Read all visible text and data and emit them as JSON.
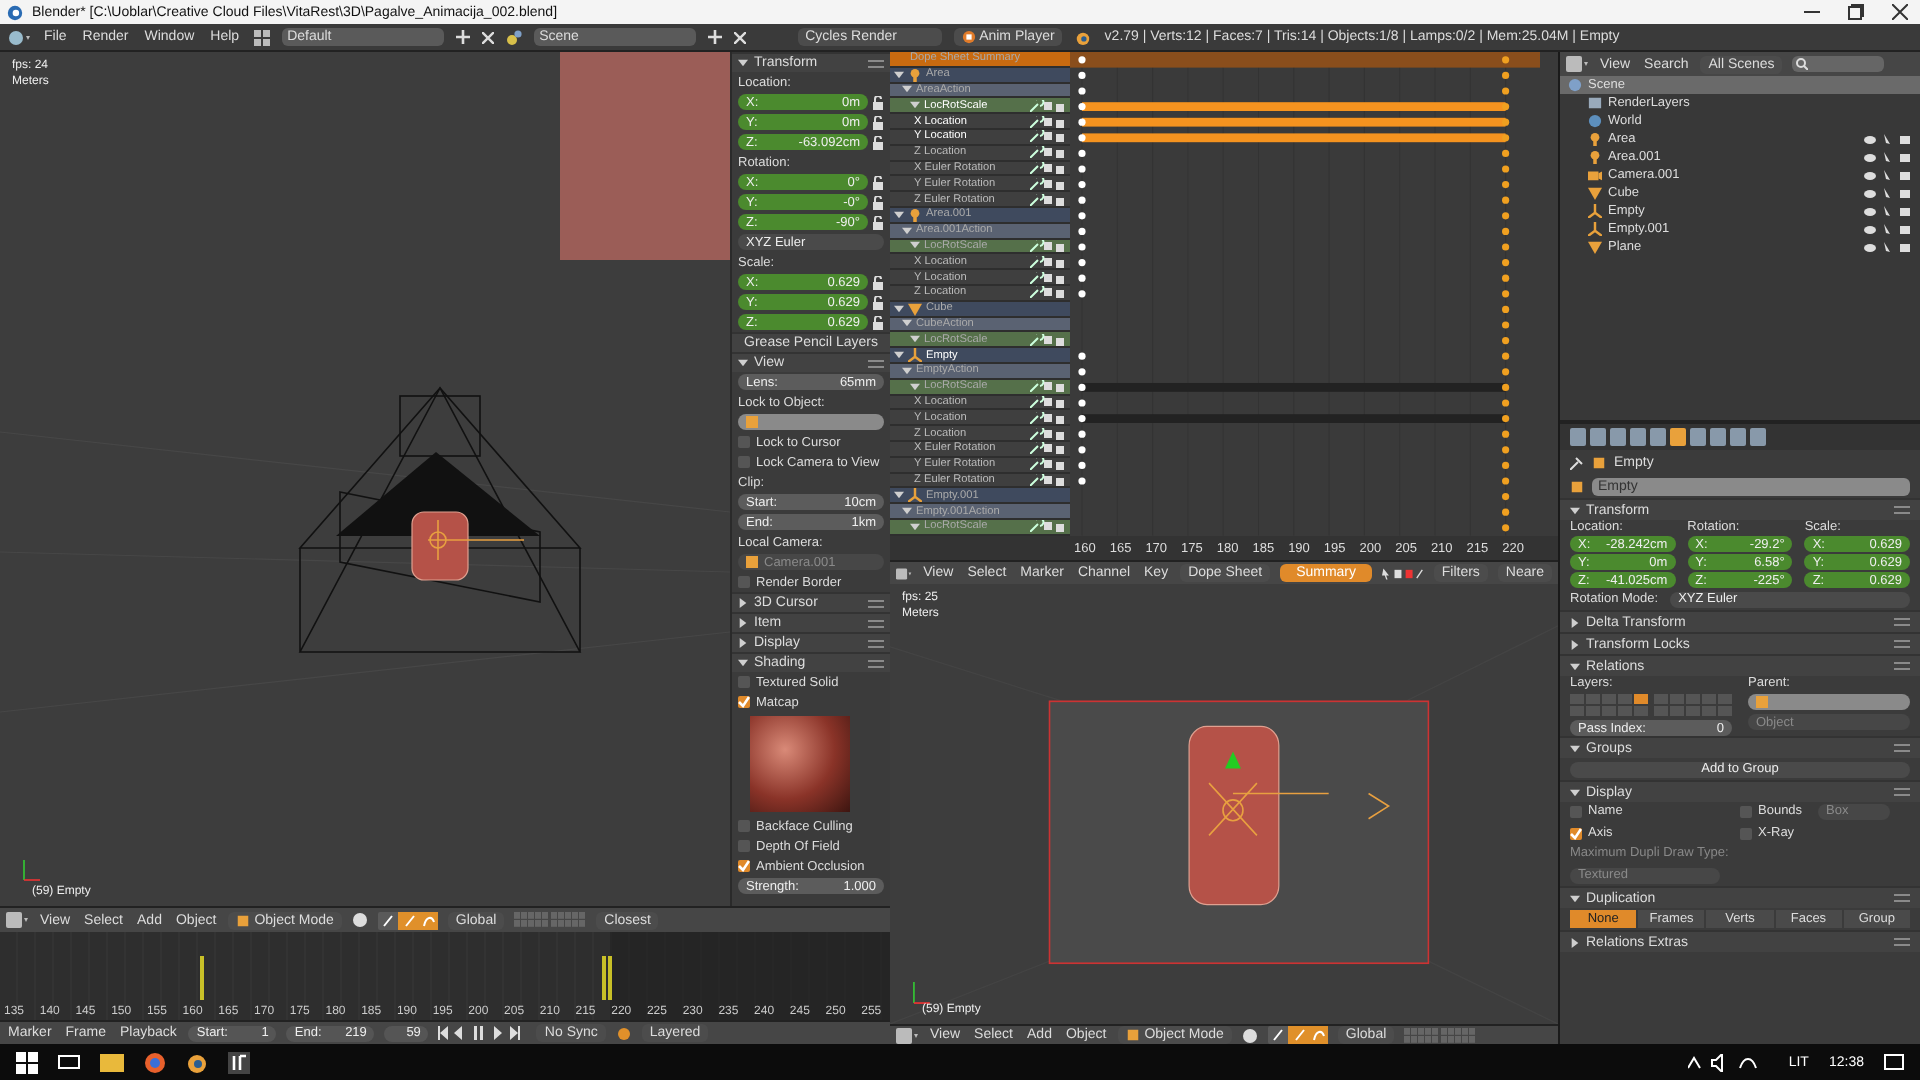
{
  "window": {
    "title": "Blender* [C:\\Uoblar\\Creative Cloud Files\\VitaRest\\3D\\Pagalve_Animacija_002.blend]"
  },
  "menubar": {
    "menus": [
      "File",
      "Render",
      "Window",
      "Help"
    ],
    "layout": "Default",
    "scene": "Scene",
    "engine": "Cycles Render",
    "player": "Anim Player",
    "stats": "v2.79 | Verts:12 | Faces:7 | Tris:14 | Objects:1/8 | Lamps:0/2 | Mem:25.04M | Empty"
  },
  "viewport": {
    "fps": "fps: 24",
    "units": "Meters",
    "object": "(59) Empty",
    "header": {
      "menus": [
        "View",
        "Select",
        "Add",
        "Object"
      ],
      "mode": "Object Mode",
      "orientation": "Global",
      "snap": "Closest"
    }
  },
  "npanel": {
    "items": [
      {
        "kind": "section",
        "title": "Transform",
        "expanded": true
      },
      {
        "kind": "label",
        "text": "Location:"
      },
      {
        "kind": "transform",
        "label": "X:",
        "value": "0m"
      },
      {
        "kind": "transform",
        "label": "Y:",
        "value": "0m"
      },
      {
        "kind": "transform",
        "label": "Z:",
        "value": "-63.092cm"
      },
      {
        "kind": "label",
        "text": "Rotation:"
      },
      {
        "kind": "transform",
        "label": "X:",
        "value": "0°"
      },
      {
        "kind": "transform",
        "label": "Y:",
        "value": "-0°"
      },
      {
        "kind": "transform",
        "label": "Z:",
        "value": "-90°"
      },
      {
        "kind": "dropdown",
        "value": "XYZ Euler"
      },
      {
        "kind": "label",
        "text": "Scale:"
      },
      {
        "kind": "transform",
        "label": "X:",
        "value": "0.629"
      },
      {
        "kind": "transform",
        "label": "Y:",
        "value": "0.629"
      },
      {
        "kind": "transform",
        "label": "Z:",
        "value": "0.629"
      },
      {
        "kind": "section",
        "title": "Grease Pencil Layers",
        "expanded": false
      },
      {
        "kind": "section",
        "title": "View",
        "expanded": true
      },
      {
        "kind": "number",
        "label": "Lens:",
        "value": "65mm"
      },
      {
        "kind": "label",
        "text": "Lock to Object:"
      },
      {
        "kind": "object_field",
        "disabled": false
      },
      {
        "kind": "checkbox",
        "label": "Lock to Cursor",
        "checked": false
      },
      {
        "kind": "checkbox",
        "label": "Lock Camera to View",
        "checked": false
      },
      {
        "kind": "label",
        "text": "Clip:"
      },
      {
        "kind": "number",
        "label": "Start:",
        "value": "10cm"
      },
      {
        "kind": "number",
        "label": "End:",
        "value": "1km"
      },
      {
        "kind": "label",
        "text": "Local Camera:"
      },
      {
        "kind": "object_field",
        "value": "Camera.001",
        "disabled": true
      },
      {
        "kind": "checkbox",
        "label": "Render Border",
        "checked": false
      },
      {
        "kind": "section",
        "title": "3D Cursor",
        "expanded": false
      },
      {
        "kind": "section",
        "title": "Item",
        "expanded": false
      },
      {
        "kind": "section",
        "title": "Display",
        "expanded": false
      },
      {
        "kind": "section",
        "title": "Shading",
        "expanded": true
      },
      {
        "kind": "checkbox",
        "label": "Textured Solid",
        "checked": false
      },
      {
        "kind": "checkbox",
        "label": "Matcap",
        "checked": true
      },
      {
        "kind": "matcap"
      },
      {
        "kind": "checkbox",
        "label": "Backface Culling",
        "checked": false
      },
      {
        "kind": "checkbox",
        "label": "Depth Of Field",
        "checked": false
      },
      {
        "kind": "checkbox",
        "label": "Ambient Occlusion",
        "checked": true
      },
      {
        "kind": "number",
        "label": "Strength:",
        "value": "1.000"
      }
    ]
  },
  "timeline": {
    "ticks": [
      "135",
      "140",
      "145",
      "150",
      "155",
      "160",
      "165",
      "170",
      "175",
      "180",
      "185",
      "190",
      "195",
      "200",
      "205",
      "210",
      "215",
      "220",
      "225",
      "230",
      "235",
      "240",
      "245",
      "250",
      "255"
    ],
    "header": {
      "menus": [
        "Marker",
        "Frame",
        "Playback"
      ],
      "start_label": "Start:",
      "start": "1",
      "end_label": "End:",
      "end": "219",
      "frame": "59",
      "sync": "No Sync",
      "keying": "Layered"
    }
  },
  "dopesheet": {
    "summary": "Dope Sheet Summary",
    "channels": [
      {
        "kind": "lamp",
        "name": "Area",
        "start_key": true,
        "held": false,
        "selected": false,
        "children": [
          {
            "kind": "action",
            "name": "AreaAction",
            "start_key": true,
            "held": false,
            "selected": false,
            "children": [
              {
                "kind": "group",
                "name": "LocRotScale",
                "start_key": true,
                "held": true,
                "selected": true,
                "children": [
                  {
                    "kind": "fcurve",
                    "name": "X Location",
                    "start_key": true,
                    "held": true,
                    "selected": true
                  },
                  {
                    "kind": "fcurve",
                    "name": "Y Location",
                    "start_key": true,
                    "held": true,
                    "selected": true
                  },
                  {
                    "kind": "fcurve",
                    "name": "Z Location",
                    "start_key": true,
                    "held": false,
                    "selected": false
                  },
                  {
                    "kind": "fcurve",
                    "name": "X Euler Rotation",
                    "start_key": true,
                    "held": false,
                    "selected": false
                  },
                  {
                    "kind": "fcurve",
                    "name": "Y Euler Rotation",
                    "start_key": true,
                    "held": false,
                    "selected": false
                  },
                  {
                    "kind": "fcurve",
                    "name": "Z Euler Rotation",
                    "start_key": true,
                    "held": false,
                    "selected": false
                  }
                ]
              }
            ]
          }
        ]
      },
      {
        "kind": "lamp",
        "name": "Area.001",
        "start_key": true,
        "held": false,
        "selected": false,
        "children": [
          {
            "kind": "action",
            "name": "Area.001Action",
            "start_key": true,
            "held": false,
            "selected": false,
            "children": [
              {
                "kind": "group",
                "name": "LocRotScale",
                "start_key": true,
                "held": false,
                "selected": false,
                "children": [
                  {
                    "kind": "fcurve",
                    "name": "X Location",
                    "start_key": true,
                    "held": false,
                    "selected": false
                  },
                  {
                    "kind": "fcurve",
                    "name": "Y Location",
                    "start_key": true,
                    "held": false,
                    "selected": false
                  },
                  {
                    "kind": "fcurve",
                    "name": "Z Location",
                    "start_key": true,
                    "held": false,
                    "selected": false
                  }
                ]
              }
            ]
          }
        ]
      },
      {
        "kind": "mesh",
        "name": "Cube",
        "start_key": false,
        "held": false,
        "selected": false,
        "children": [
          {
            "kind": "action",
            "name": "CubeAction",
            "start_key": false,
            "held": false,
            "selected": false,
            "children": [
              {
                "kind": "group",
                "name": "LocRotScale",
                "start_key": false,
                "held": false,
                "selected": false
              }
            ]
          }
        ]
      },
      {
        "kind": "empty",
        "name": "Empty",
        "start_key": true,
        "held": false,
        "selected": true,
        "children": [
          {
            "kind": "action",
            "name": "EmptyAction",
            "start_key": true,
            "held": false,
            "selected": false,
            "children": [
              {
                "kind": "group",
                "name": "LocRotScale",
                "start_key": true,
                "held": true,
                "selected": false,
                "children": [
                  {
                    "kind": "fcurve",
                    "name": "X Location",
                    "start_key": true,
                    "held": false,
                    "selected": false
                  },
                  {
                    "kind": "fcurve",
                    "name": "Y Location",
                    "start_key": true,
                    "held": true,
                    "selected": false
                  },
                  {
                    "kind": "fcurve",
                    "name": "Z Location",
                    "start_key": true,
                    "held": false,
                    "selected": false
                  },
                  {
                    "kind": "fcurve",
                    "name": "X Euler Rotation",
                    "start_key": true,
                    "held": false,
                    "selected": false
                  },
                  {
                    "kind": "fcurve",
                    "name": "Y Euler Rotation",
                    "start_key": true,
                    "held": false,
                    "selected": false
                  },
                  {
                    "kind": "fcurve",
                    "name": "Z Euler Rotation",
                    "start_key": true,
                    "held": false,
                    "selected": false
                  }
                ]
              }
            ]
          }
        ]
      },
      {
        "kind": "empty",
        "name": "Empty.001",
        "start_key": false,
        "held": false,
        "selected": false,
        "children": [
          {
            "kind": "action",
            "name": "Empty.001Action",
            "start_key": false,
            "held": false,
            "selected": false,
            "children": [
              {
                "kind": "group",
                "name": "LocRotScale",
                "start_key": false,
                "held": false,
                "selected": false
              }
            ]
          }
        ]
      }
    ],
    "ruler": [
      "160",
      "165",
      "170",
      "175",
      "180",
      "185",
      "190",
      "195",
      "200",
      "205",
      "210",
      "215",
      "220"
    ],
    "header": {
      "menus": [
        "View",
        "Select",
        "Marker",
        "Channel",
        "Key"
      ],
      "mode": "Dope Sheet",
      "summary": {
        "label": "Summary",
        "on": true
      },
      "filters": "Filters",
      "snap": "Neare"
    }
  },
  "camera_view": {
    "fps": "fps: 25",
    "units": "Meters",
    "object": "(59) Empty",
    "header": {
      "menus": [
        "View",
        "Select",
        "Add",
        "Object"
      ],
      "mode": "Object Mode",
      "orientation": "Global"
    }
  },
  "outliner": {
    "header": {
      "menus": [
        "View",
        "Search"
      ],
      "scenes": "All Scenes"
    },
    "tree": [
      {
        "name": "Scene",
        "kind": "scene",
        "selected": true,
        "children": [
          {
            "name": "RenderLayers",
            "kind": "layers",
            "selected": false
          },
          {
            "name": "World",
            "kind": "world",
            "selected": false
          },
          {
            "name": "Area",
            "kind": "lamp",
            "selected": false
          },
          {
            "name": "Area.001",
            "kind": "lamp",
            "selected": false
          },
          {
            "name": "Camera.001",
            "kind": "camera",
            "selected": false
          },
          {
            "name": "Cube",
            "kind": "mesh",
            "selected": false
          },
          {
            "name": "Empty",
            "kind": "empty",
            "selected": false
          },
          {
            "name": "Empty.001",
            "kind": "empty",
            "selected": false
          },
          {
            "name": "Plane",
            "kind": "mesh",
            "selected": false
          }
        ]
      }
    ]
  },
  "properties": {
    "object": "Empty",
    "name": "Empty",
    "sections": [
      {
        "kind": "transform",
        "title": "Transform",
        "expanded": true,
        "columns": [
          {
            "label": "Location:",
            "fields": [
              {
                "axis": "X:",
                "value": "-28.242cm"
              },
              {
                "axis": "Y:",
                "value": "0m"
              },
              {
                "axis": "Z:",
                "value": "-41.025cm"
              }
            ]
          },
          {
            "label": "Rotation:",
            "fields": [
              {
                "axis": "X:",
                "value": "-29.2°"
              },
              {
                "axis": "Y:",
                "value": "6.58°"
              },
              {
                "axis": "Z:",
                "value": "-225°"
              }
            ]
          },
          {
            "label": "Scale:",
            "fields": [
              {
                "axis": "X:",
                "value": "0.629"
              },
              {
                "axis": "Y:",
                "value": "0.629"
              },
              {
                "axis": "Z:",
                "value": "0.629"
              }
            ]
          }
        ],
        "mode_label": "Rotation Mode:",
        "mode": "XYZ Euler"
      },
      {
        "kind": "collapsed",
        "title": "Delta Transform",
        "expanded": false
      },
      {
        "kind": "collapsed",
        "title": "Transform Locks",
        "expanded": false
      },
      {
        "kind": "relations",
        "title": "Relations",
        "expanded": true,
        "layers_label": "Layers:",
        "parent_label": "Parent:",
        "parent_type": "Object",
        "pass_label": "Pass Index:",
        "pass_value": "0",
        "layers": [
          {
            "selected": false
          },
          {
            "selected": false
          },
          {
            "selected": false
          },
          {
            "selected": false
          },
          {
            "selected": true
          },
          {
            "selected": false
          },
          {
            "selected": false
          },
          {
            "selected": false
          },
          {
            "selected": false
          },
          {
            "selected": false
          },
          {
            "selected": false
          },
          {
            "selected": false
          },
          {
            "selected": false
          },
          {
            "selected": false
          },
          {
            "selected": false
          },
          {
            "selected": false
          },
          {
            "selected": false
          },
          {
            "selected": false
          },
          {
            "selected": false
          },
          {
            "selected": false
          }
        ]
      },
      {
        "kind": "groups",
        "title": "Groups",
        "expanded": true,
        "button": "Add to Group"
      },
      {
        "kind": "display",
        "title": "Display",
        "expanded": true,
        "options": [
          {
            "label": "Name",
            "checked": false
          },
          {
            "label": "Bounds",
            "checked": false,
            "type": "Box"
          },
          {
            "label": "Axis",
            "checked": true
          },
          {
            "label": "X-Ray",
            "checked": false
          }
        ],
        "dupli_label": "Maximum Dupli Draw Type:",
        "dupli_type": "Textured"
      },
      {
        "kind": "duplication",
        "title": "Duplication",
        "expanded": true,
        "options": [
          {
            "label": "None",
            "selected": true
          },
          {
            "label": "Frames",
            "selected": false
          },
          {
            "label": "Verts",
            "selected": false
          },
          {
            "label": "Faces",
            "selected": false
          },
          {
            "label": "Group",
            "selected": false
          }
        ]
      },
      {
        "kind": "collapsed",
        "title": "Relations Extras",
        "expanded": false
      }
    ]
  },
  "taskbar": {
    "language": "LIT",
    "time": "12:38"
  }
}
